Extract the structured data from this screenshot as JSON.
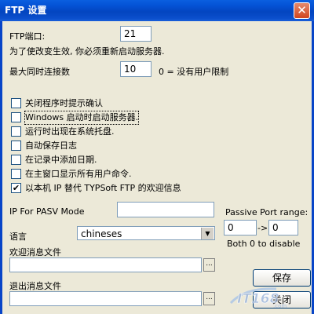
{
  "window": {
    "title": "FTP 设置",
    "close_glyph": "✕"
  },
  "ftp_port": {
    "label": "FTP端口:",
    "value": "21"
  },
  "restart_note": "为了使改变生效, 你必须重新启动服务器.",
  "max_connections": {
    "label": "最大同时连接数",
    "value": "10",
    "hint": "0 = 没有用户限制"
  },
  "checkboxes": [
    {
      "label": "关闭程序时提示确认",
      "checked": false
    },
    {
      "label": "Windows 启动时启动服务器.",
      "checked": false
    },
    {
      "label": "运行时出现在系统托盘.",
      "checked": false
    },
    {
      "label": "自动保存日志",
      "checked": false
    },
    {
      "label": "在记录中添加日期.",
      "checked": false
    },
    {
      "label": "在主窗口显示所有用户命令.",
      "checked": false
    },
    {
      "label": "以本机 IP 替代 TYPSoft FTP 的欢迎信息",
      "checked": true
    }
  ],
  "pasv": {
    "label": "IP For PASV Mode",
    "value": ""
  },
  "passive_range": {
    "label": "Passive Port range:",
    "from": "0",
    "arrow": "->",
    "to": "0",
    "note": "Both 0 to disable"
  },
  "language": {
    "label": "语言",
    "value": "chineses"
  },
  "welcome_file": {
    "label": "欢迎消息文件",
    "value": "",
    "browse": "..."
  },
  "exit_file": {
    "label": "退出消息文件",
    "value": "",
    "browse": "..."
  },
  "buttons": {
    "save": "保存",
    "close": "关闭"
  },
  "watermark": {
    "text": "IT168",
    "suffix": ".com"
  },
  "colors": {
    "titlebar": "#0453d6",
    "dialog_bg": "#ece9d8",
    "input_border": "#7f9db9"
  }
}
